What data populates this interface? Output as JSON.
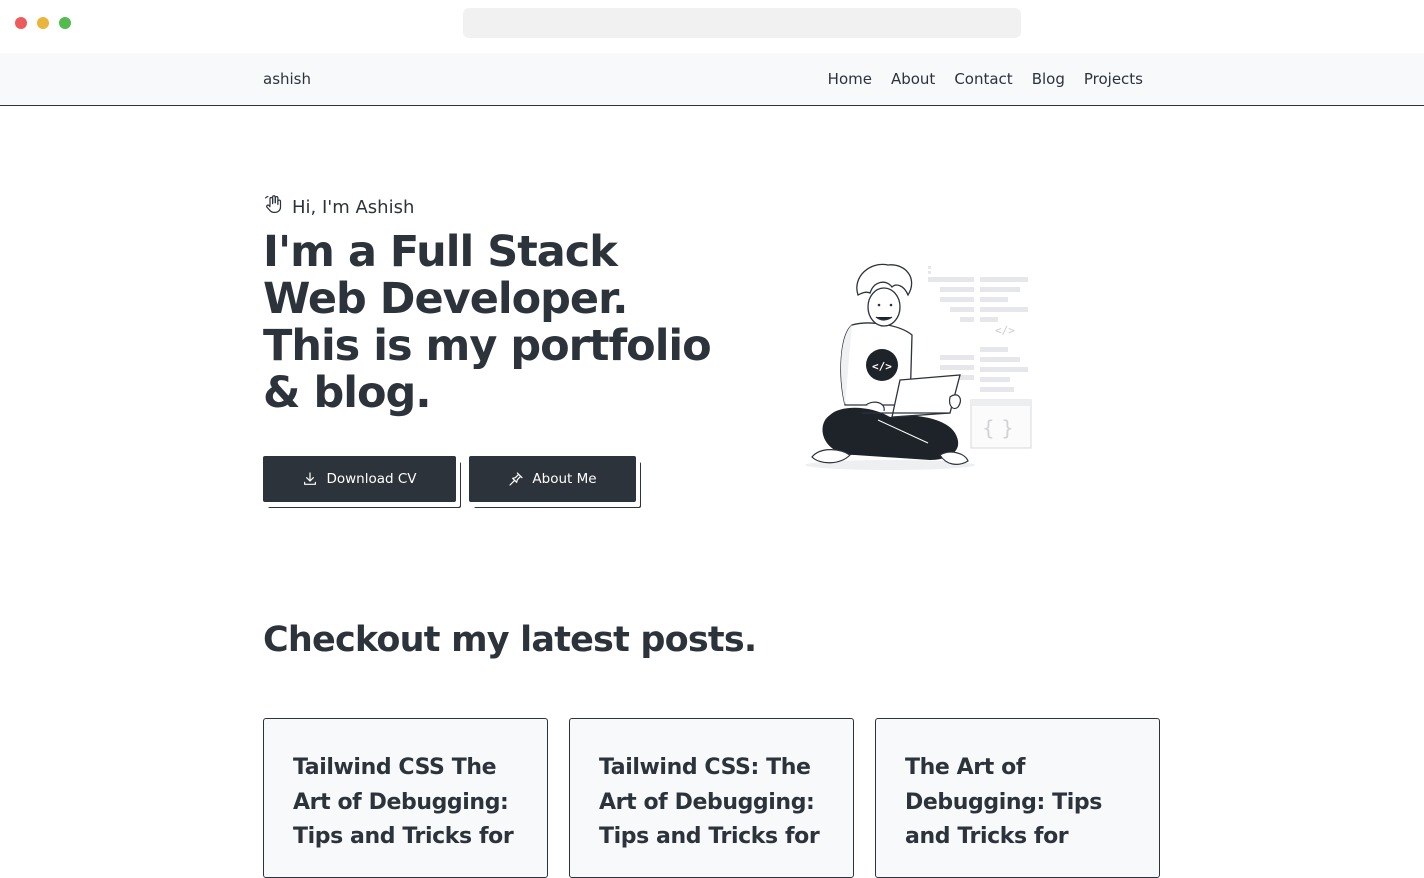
{
  "nav": {
    "brand": "ashish",
    "links": [
      "Home",
      "About",
      "Contact",
      "Blog",
      "Projects"
    ]
  },
  "hero": {
    "greeting": "Hi, I'm Ashish",
    "headline_lines": [
      "I'm a Full Stack",
      "Web Developer.",
      "This is my portfolio",
      "& blog."
    ],
    "buttons": {
      "download_cv": "Download CV",
      "about_me": "About Me"
    }
  },
  "posts": {
    "title": "Checkout my latest posts.",
    "cards": [
      {
        "title": "Tailwind CSS The Art of Debugging: Tips and Tricks for"
      },
      {
        "title": "Tailwind CSS: The Art of Debugging: Tips and Tricks for"
      },
      {
        "title": "The Art of Debugging: Tips and Tricks for"
      }
    ]
  }
}
